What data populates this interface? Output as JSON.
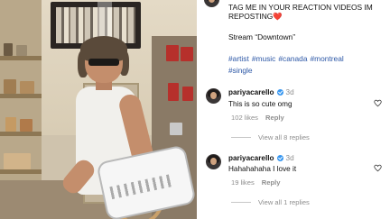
{
  "post": {
    "caption_line1": "TAG ME IN YOUR REACTION VIDEOS IM",
    "caption_line2": "REPOSTING",
    "caption_emoji": "❤️",
    "stream_line": "Stream “Downtown”",
    "hashtags": [
      "#artist",
      "#music",
      "#canada",
      "#montreal",
      "#single"
    ]
  },
  "comments": [
    {
      "username": "pariyacarello",
      "age": "3d",
      "text": "This is so cute omg",
      "likes": "102 likes",
      "reply_label": "Reply",
      "view_replies": "View all 8 replies"
    },
    {
      "username": "pariyacarello",
      "age": "3d",
      "text": "Hahahahaha I love it",
      "likes": "19 likes",
      "reply_label": "Reply",
      "view_replies": "View all 1 replies"
    }
  ],
  "icons": {
    "like": "heart-outline-icon",
    "verified": "verified-badge-icon",
    "heart_emoji": "red-heart-emoji"
  },
  "colors": {
    "hashtag": "#2c57a6",
    "verified": "#3897f0",
    "muted": "#8e8e8e"
  }
}
